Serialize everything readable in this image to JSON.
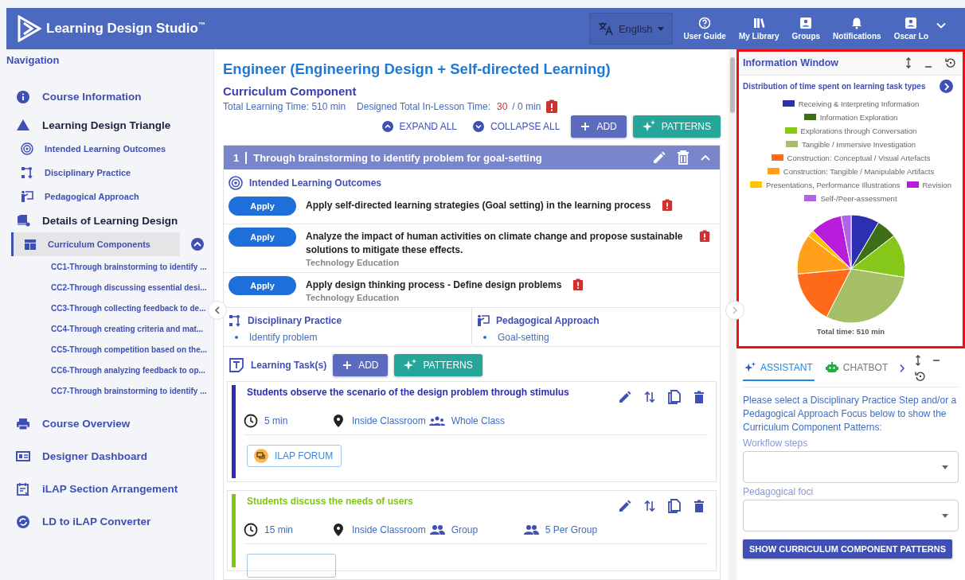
{
  "header": {
    "brand": "Learning Design Studio",
    "trademark": "™",
    "language": "English",
    "nav": [
      {
        "label": "User Guide"
      },
      {
        "label": "My Library"
      },
      {
        "label": "Groups"
      },
      {
        "label": "Notifications"
      },
      {
        "label": "Oscar Lo"
      }
    ]
  },
  "sidebar": {
    "title": "Navigation",
    "items": [
      {
        "label": "Course Information",
        "kind": "link"
      },
      {
        "label": "Learning Design Triangle",
        "kind": "section",
        "children": [
          {
            "label": "Intended Learning Outcomes",
            "selected": false
          },
          {
            "label": "Disciplinary Practice",
            "selected": false
          },
          {
            "label": "Pedagogical Approach",
            "selected": false
          }
        ]
      },
      {
        "label": "Details of Learning Design",
        "kind": "section",
        "children": [
          {
            "label": "Curriculum Components",
            "selected": true,
            "expanded": true,
            "children": [
              {
                "label": "CC1-Through brainstorming to identify ..."
              },
              {
                "label": "CC2-Through discussing essential desi..."
              },
              {
                "label": "CC3-Through collecting feedback to de..."
              },
              {
                "label": "CC4-Through creating criteria and mat..."
              },
              {
                "label": "CC5-Through competition based on the..."
              },
              {
                "label": "CC6-Through analyzing feedback to op..."
              },
              {
                "label": "CC7-Through brainstorming to identify ..."
              }
            ]
          }
        ]
      },
      {
        "label": "Course Overview",
        "kind": "link"
      },
      {
        "label": "Designer Dashboard",
        "kind": "link"
      },
      {
        "label": "iLAP Section Arrangement",
        "kind": "link"
      },
      {
        "label": "LD to iLAP Converter",
        "kind": "link"
      }
    ]
  },
  "main": {
    "title": "Engineer (Engineering Design + Self-directed Learning)",
    "subtitle": "Curriculum Component",
    "total_time": "Total Learning Time: 510 min",
    "designed_label": "Designed Total In-Lesson Time:",
    "designed_value": "30",
    "designed_rest": "/ 0 min",
    "designed_warning": true,
    "expand_all": "EXPAND ALL",
    "collapse_all": "COLLAPSE ALL",
    "add": "ADD",
    "patterns": "PATTERNS",
    "component": {
      "number": "1",
      "title": "Through brainstorming to identify problem for goal-setting",
      "expanded": true,
      "ilo_heading": "Intended Learning Outcomes",
      "outcomes": [
        {
          "level": "Apply",
          "text": "Apply self-directed learning strategies (Goal setting) in the learning process",
          "warning": true
        },
        {
          "level": "Apply",
          "text": "Analyze the impact of human activities on climate change and propose sustainable solutions to mitigate these effects.",
          "subject": "Technology Education",
          "warning": true
        },
        {
          "level": "Apply",
          "text": "Apply design thinking process - Define design problems",
          "subject": "Technology Education",
          "warning": true
        }
      ],
      "practice": {
        "heading": "Disciplinary Practice",
        "items": [
          "Identify problem"
        ]
      },
      "approach": {
        "heading": "Pedagogical Approach",
        "items": [
          "Goal-setting"
        ]
      },
      "tasks_heading": "Learning Task(s)",
      "tasks_add": "ADD",
      "tasks_patterns": "PATTERNS",
      "tasks": [
        {
          "title": "Students observe the scenario of the design problem through stimulus",
          "color": "#2b2fb0",
          "duration": "5 min",
          "location": "Inside Classroom",
          "grouping": "Whole Class",
          "tool": "ILAP FORUM"
        },
        {
          "title": "Students discuss the needs of users",
          "color": "#7ec80e",
          "duration": "15 min",
          "location": "Inside Classroom",
          "grouping": "Group",
          "group_size": "5 Per Group"
        }
      ]
    }
  },
  "info": {
    "title": "Information Window",
    "highlighted": true,
    "chart_title": "Distribution of time spent on learning task types",
    "legend": [
      {
        "label": "Receiving & Interpreting Information",
        "color": "#2b2fb0"
      },
      {
        "label": "Information Exploration",
        "color": "#3e6f16"
      },
      {
        "label": "Explorations through Conversation",
        "color": "#86c81a"
      },
      {
        "label": "Tangible / Immersive Investigation",
        "color": "#a4bf66"
      },
      {
        "label": "Construction: Conceptual / Visual Artefacts",
        "color": "#ff6a1a"
      },
      {
        "label": "Construction: Tangible / Manipulable Artifacts",
        "color": "#ff9f1a"
      },
      {
        "label": "Presentations, Performance Illustrations",
        "color": "#ffc400"
      },
      {
        "label": "Revision",
        "color": "#b91ddc"
      },
      {
        "label": "Self-/Peer-assessment",
        "color": "#b063e8"
      }
    ],
    "total": "Total time: 510 min"
  },
  "assistant": {
    "tabs": [
      {
        "label": "ASSISTANT",
        "selected": true
      },
      {
        "label": "CHATBOT",
        "selected": false
      }
    ],
    "prompt": "Please select a Disciplinary Practice Step and/or a Pedagogical Approach Focus below to show the Curriculum Component Patterns:",
    "fields": [
      {
        "label": "Workflow steps"
      },
      {
        "label": "Pedagogical foci"
      }
    ],
    "button": "SHOW CURRICULUM COMPONENT PATTERNS"
  }
}
